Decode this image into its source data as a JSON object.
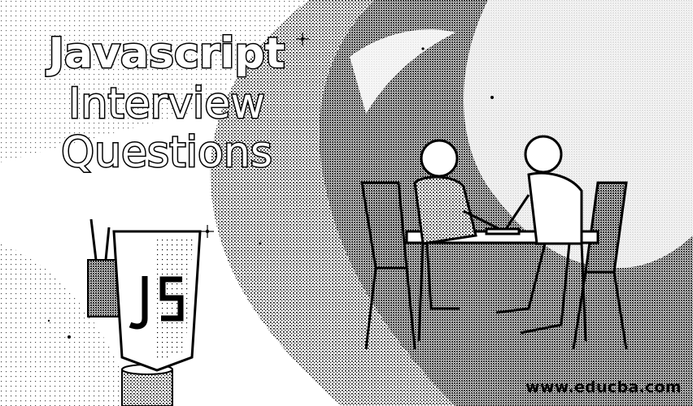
{
  "banner": {
    "title_line1": "Javascript",
    "title_line2": "Interview",
    "title_line3": "Questions",
    "website": "www.educba.com",
    "logo_text": "JS"
  },
  "colors": {
    "ink": "#000000",
    "paper": "#ffffff",
    "texture": "#9a9a9a"
  },
  "icons": [
    "javascript-shield-icon",
    "interview-scene-illustration",
    "pen-holder-icon",
    "mug-icon"
  ]
}
